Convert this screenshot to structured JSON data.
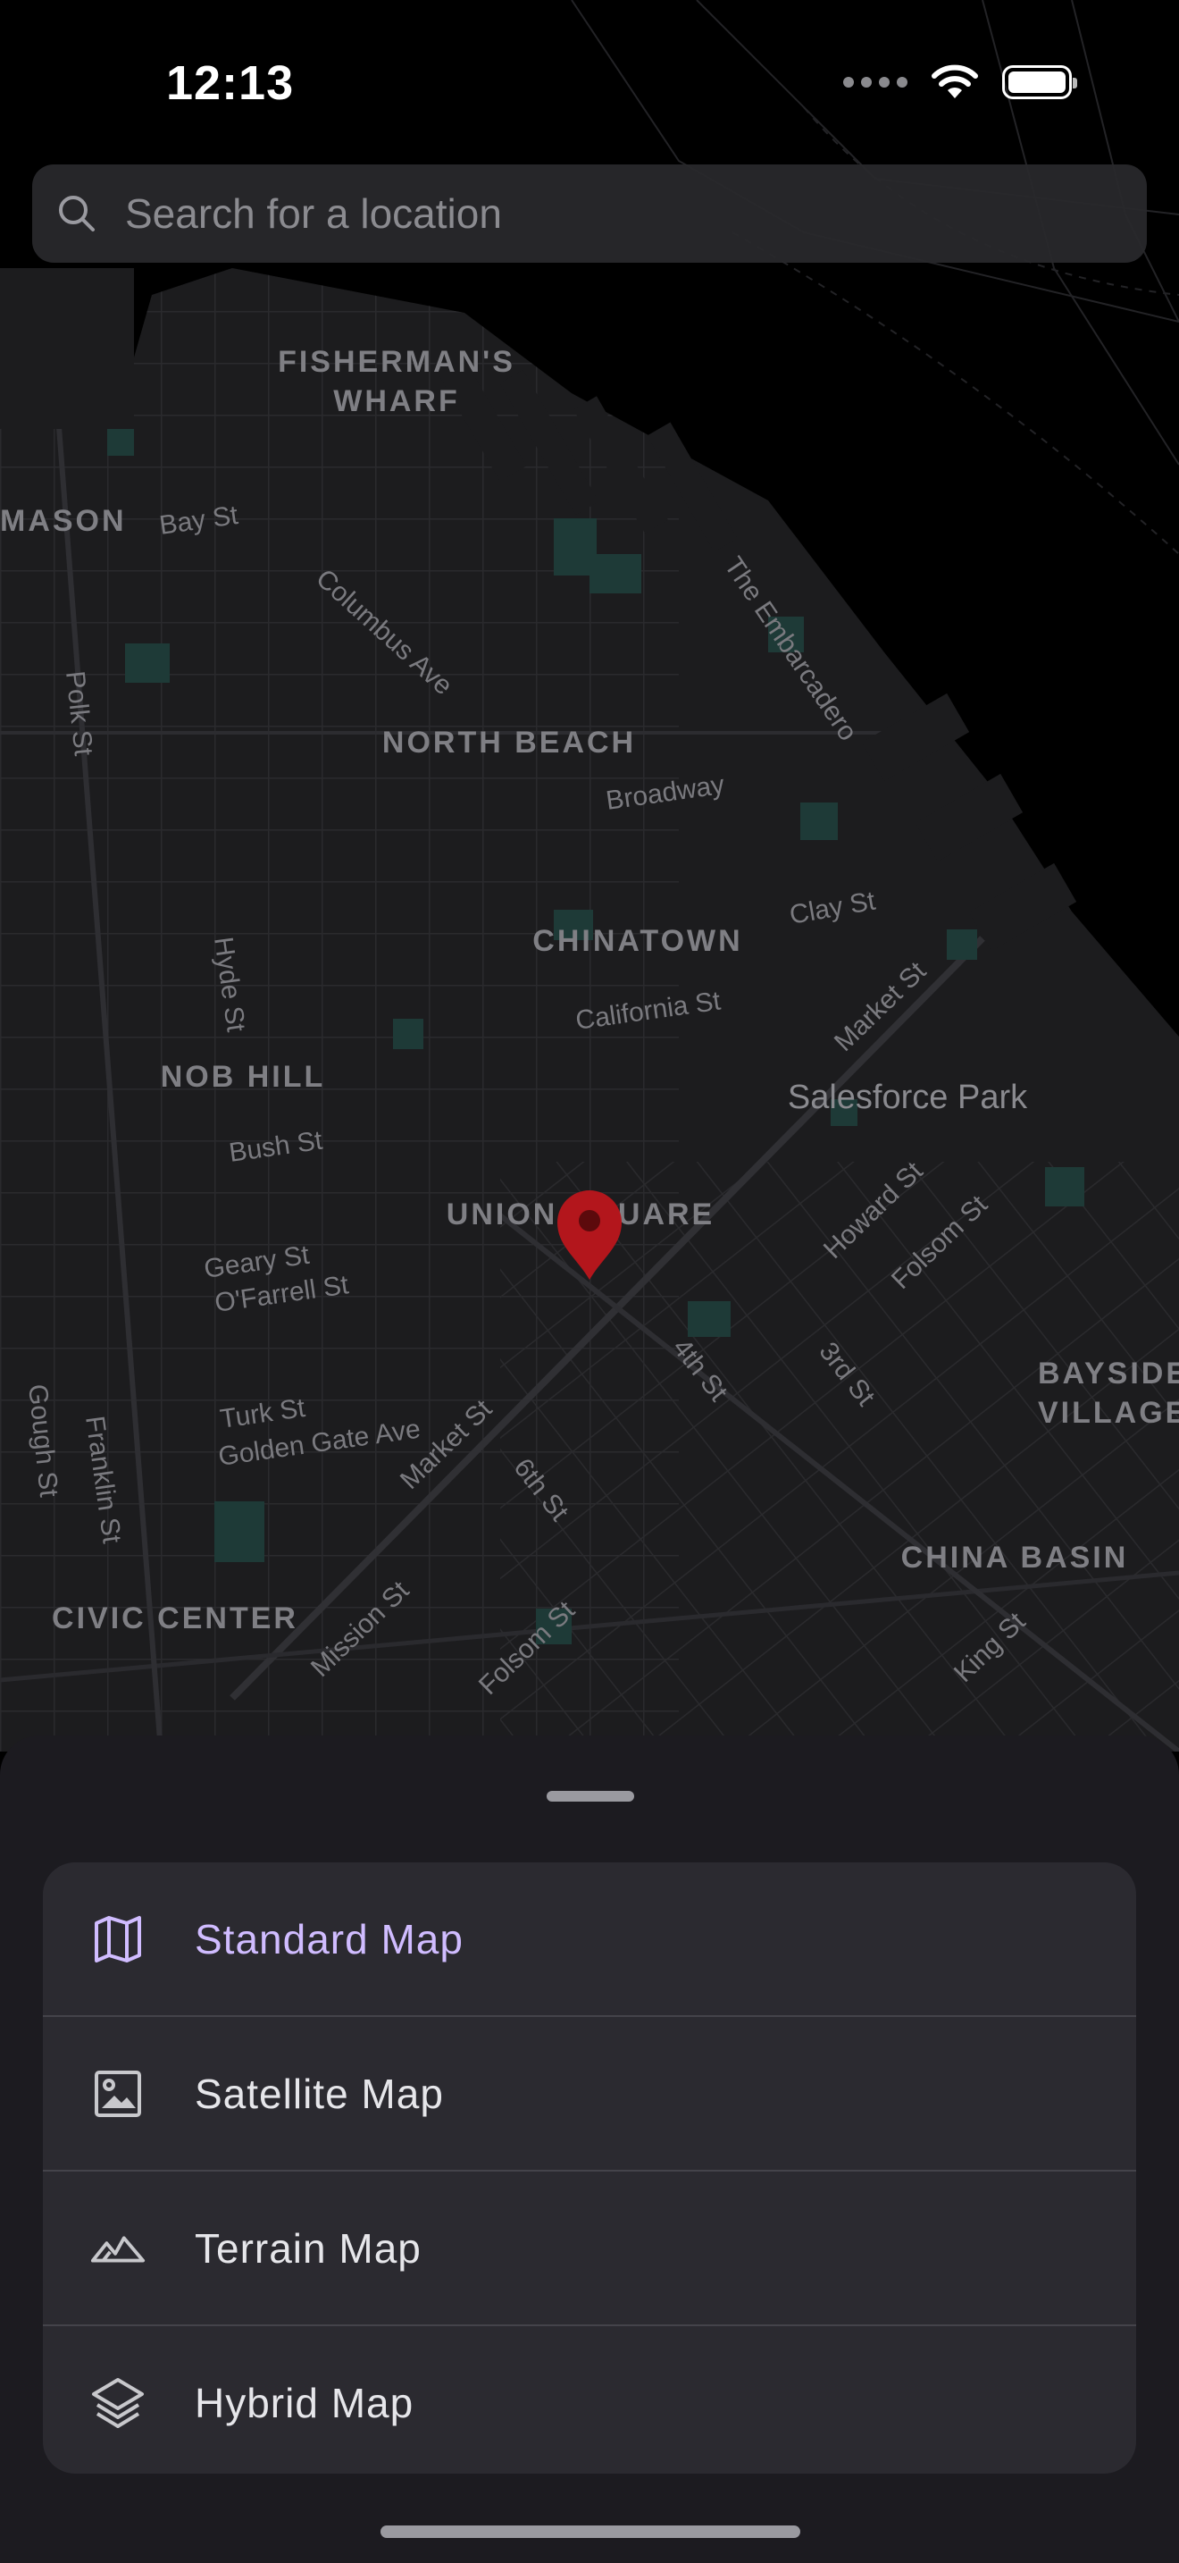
{
  "status_bar": {
    "time": "12:13"
  },
  "search": {
    "placeholder": "Search for a location",
    "value": ""
  },
  "map": {
    "districts": [
      "FISHERMAN'S",
      "WHARF",
      "MASON",
      "NORTH BEACH",
      "CHINATOWN",
      "NOB HILL",
      "UNION SQUARE",
      "BAYSIDE",
      "VILLAGE",
      "CHINA BASIN",
      "CIVIC CENTER"
    ],
    "streets": [
      "Bay St",
      "Columbus Ave",
      "Polk St",
      "The Embarcadero",
      "Broadway",
      "Clay St",
      "Hyde St",
      "California St",
      "Market St",
      "Bush St",
      "Howard St",
      "Folsom St",
      "Geary St",
      "O'Farrell St",
      "4th St",
      "3rd St",
      "Turk St",
      "Golden Gate Ave",
      "Market St",
      "Gough St",
      "Franklin St",
      "6th St",
      "Mission St",
      "Folsom St",
      "King St"
    ],
    "places": [
      "Salesforce Park"
    ]
  },
  "map_types": [
    {
      "label": "Standard Map",
      "icon": "map-icon",
      "selected": true
    },
    {
      "label": "Satellite Map",
      "icon": "image-icon",
      "selected": false
    },
    {
      "label": "Terrain Map",
      "icon": "terrain-icon",
      "selected": false
    },
    {
      "label": "Hybrid Map",
      "icon": "layers-icon",
      "selected": false
    }
  ],
  "colors": {
    "accent": "#d0bcff",
    "marker": "#b3161c",
    "sheet_background": "#1c1b20",
    "card_background": "#2b2a30",
    "map_land": "#1c1c1e",
    "map_water": "#000000",
    "map_park": "#1e3a37"
  }
}
